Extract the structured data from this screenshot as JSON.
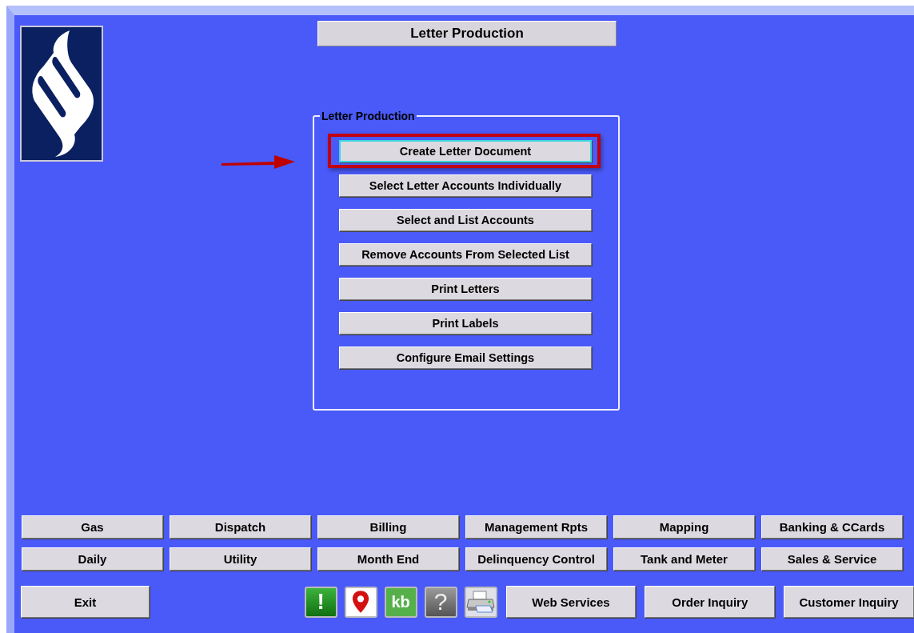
{
  "window": {
    "title": "Letter Production"
  },
  "group": {
    "title": "Letter Production",
    "buttons": [
      {
        "label": "Create Letter Document",
        "selected": true
      },
      {
        "label": "Select Letter Accounts Individually",
        "selected": false
      },
      {
        "label": "Select and List Accounts",
        "selected": false
      },
      {
        "label": "Remove Accounts From Selected List",
        "selected": false
      },
      {
        "label": "Print Letters",
        "selected": false
      },
      {
        "label": "Print Labels",
        "selected": false
      },
      {
        "label": "Configure Email Settings",
        "selected": false
      }
    ]
  },
  "nav_rows": [
    [
      "Gas",
      "Dispatch",
      "Billing",
      "Management Rpts",
      "Mapping",
      "Banking & CCards"
    ],
    [
      "Daily",
      "Utility",
      "Month End",
      "Delinquency Control",
      "Tank and Meter",
      "Sales & Service"
    ]
  ],
  "bottom_bar": {
    "exit": "Exit",
    "icon_buttons": [
      {
        "kind": "alert",
        "glyph": "!"
      },
      {
        "kind": "pin"
      },
      {
        "kind": "kb",
        "glyph": "kb"
      },
      {
        "kind": "help",
        "glyph": "?"
      },
      {
        "kind": "printer"
      }
    ],
    "buttons": [
      "Web Services",
      "Order Inquiry",
      "Customer Inquiry"
    ]
  }
}
